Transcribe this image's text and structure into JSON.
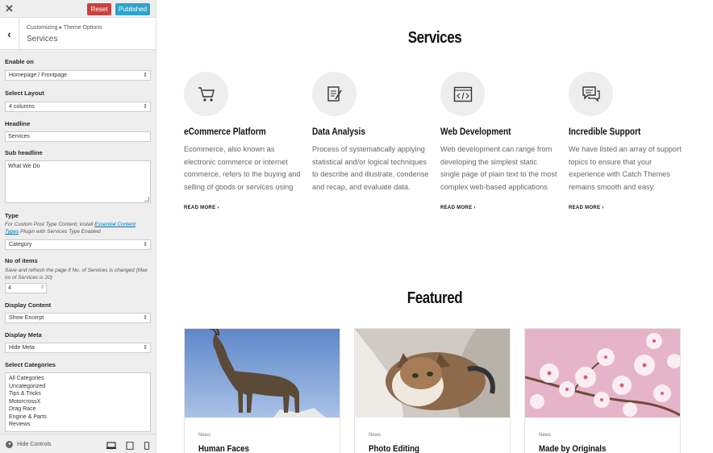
{
  "topbar": {
    "close_icon": "close-icon",
    "reset_label": "Reset",
    "published_label": "Published",
    "reset_color": "#c7423f",
    "published_color": "#2ea2cc"
  },
  "header": {
    "breadcrumb": "Customizing ▸ Theme Options",
    "section_title": "Services"
  },
  "controls": {
    "enable_on": {
      "label": "Enable on",
      "value": "Homepage / Frontpage"
    },
    "select_layout": {
      "label": "Select Layout",
      "value": "4 columns"
    },
    "headline": {
      "label": "Headline",
      "value": "Services"
    },
    "sub_headline": {
      "label": "Sub headline",
      "value": "What We Do"
    },
    "type": {
      "label": "Type",
      "desc_before": "For Custom Post Type Content, install ",
      "desc_link": "Essential Content Types",
      "desc_after": " Plugin with Services Type Enabled",
      "value": "Category"
    },
    "no_of_items": {
      "label": "No of items",
      "desc": "Save and refresh the page if No. of Services is changed (Max no of Services is 20)",
      "value": "4"
    },
    "display_content": {
      "label": "Display Content",
      "value": "Show Excerpt"
    },
    "display_meta": {
      "label": "Display Meta",
      "value": "Hide Meta"
    },
    "select_categories": {
      "label": "Select Categories",
      "options": [
        "All Categories",
        "Uncategorized",
        "Tips & Tricks",
        "MotorcrossX",
        "Drag Race",
        "Engine & Parts",
        "Reviews"
      ]
    }
  },
  "footer": {
    "hide_controls": "Hide Controls",
    "devices": [
      "desktop-icon",
      "tablet-icon",
      "mobile-icon"
    ]
  },
  "preview": {
    "services_title": "Services",
    "services": [
      {
        "icon": "cart-icon",
        "title": "eCommerce Platform",
        "text": "Ecommerce, also known as electronic commerce or internet commerce, refers to the buying and selling of goods or services using",
        "more": "READ MORE ›"
      },
      {
        "icon": "document-icon",
        "title": "Data Analysis",
        "text": "Process of systematically applying statistical and/or logical techniques to describe and illustrate, condense and recap, and evaluate data.",
        "more": ""
      },
      {
        "icon": "code-window-icon",
        "title": "Web Development",
        "text": "Web development can range from developing the simplest static single page of plain text to the most complex web-based applications",
        "more": "READ MORE ›"
      },
      {
        "icon": "chat-icon",
        "title": "Incredible Support",
        "text": "We have listed an array of support topics to ensure that your experience with Catch Themes remains smooth and easy.",
        "more": "READ MORE ›"
      }
    ],
    "featured_title": "Featured",
    "featured": [
      {
        "image": "goat-photo",
        "category": "News",
        "title": "Human Faces"
      },
      {
        "image": "cat-photo",
        "category": "News",
        "title": "Photo Editing"
      },
      {
        "image": "blossom-photo",
        "category": "News",
        "title": "Made by Originals"
      }
    ]
  }
}
